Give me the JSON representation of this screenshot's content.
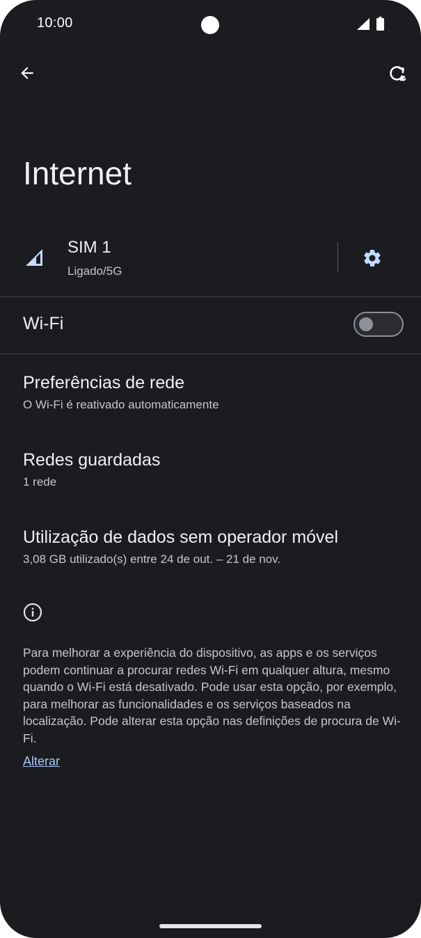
{
  "status_bar": {
    "time": "10:00"
  },
  "page": {
    "title": "Internet"
  },
  "sim": {
    "name": "SIM 1",
    "status": "Ligado/5G"
  },
  "wifi": {
    "label": "Wi-Fi",
    "enabled": false
  },
  "items": [
    {
      "title": "Preferências de rede",
      "subtitle": "O Wi-Fi é reativado automaticamente"
    },
    {
      "title": "Redes guardadas",
      "subtitle": "1 rede"
    },
    {
      "title": "Utilização de dados sem operador móvel",
      "subtitle": "3,08 GB utilizado(s) entre 24 de out. – 21 de nov."
    }
  ],
  "footer": {
    "text": "Para melhorar a experiência do dispositivo, as apps e os serviços podem continuar a procurar redes Wi-Fi em qualquer altura, mesmo quando o Wi-Fi está desativado. Pode usar esta opção, por exemplo, para melhorar as funcionalidades e os serviços baseados na localização. Pode alterar esta opção nas definições de procura de Wi-Fi.",
    "link": "Alterar"
  },
  "icons": {
    "back": "arrow-back-icon",
    "reset": "network-reset-icon",
    "sim_signal": "signal-icon",
    "settings": "gear-icon",
    "info": "info-icon",
    "battery": "battery-icon"
  },
  "colors": {
    "background": "#1b1c1f",
    "accent": "#a8c7fa",
    "sim_signal": "#c2dbff"
  }
}
